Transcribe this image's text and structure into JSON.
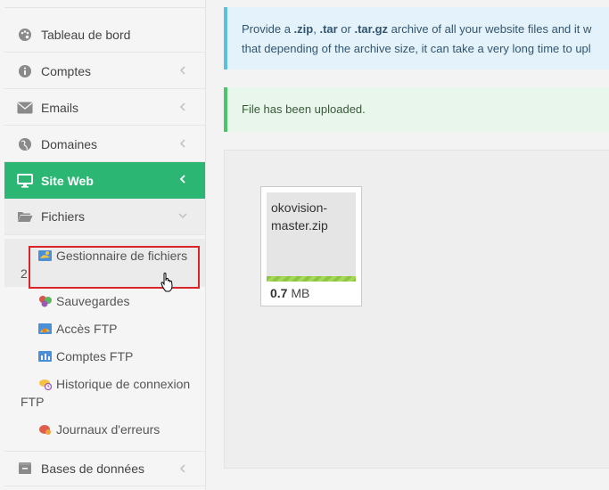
{
  "sidebar": {
    "items": [
      {
        "label": "Tableau de bord",
        "icon": "palette-icon"
      },
      {
        "label": "Comptes",
        "icon": "info-icon"
      },
      {
        "label": "Emails",
        "icon": "envelope-icon"
      },
      {
        "label": "Domaines",
        "icon": "globe-icon"
      },
      {
        "label": "Site Web",
        "icon": "monitor-icon",
        "active": true
      },
      {
        "label": "Fichiers",
        "icon": "folder-open-icon",
        "expanded": true
      },
      {
        "label": "Bases de données",
        "icon": "database-icon"
      }
    ],
    "submenu": [
      {
        "line1": "Gestionnaire de fichiers",
        "line2": "2",
        "icon": "file-manager-icon"
      },
      {
        "line1": "Sauvegardes",
        "icon": "backup-icon"
      },
      {
        "line1": "Accès FTP",
        "icon": "ftp-access-icon"
      },
      {
        "line1": "Comptes FTP",
        "icon": "ftp-accounts-icon"
      },
      {
        "line1": "Historique de connexion",
        "line2": "FTP",
        "icon": "connection-history-icon"
      },
      {
        "line1": "Journaux d'erreurs",
        "icon": "error-logs-icon"
      }
    ]
  },
  "info_alert": {
    "p1": "Provide a ",
    "ext1": ".zip",
    "p2": ", ",
    "ext2": ".tar",
    "p3": " or ",
    "ext3": ".tar.gz",
    "p4": " archive of all your website files and it w",
    "line2": "that depending of the archive size, it can take a very long time to upl"
  },
  "success_alert": {
    "text": "File has been uploaded."
  },
  "upload": {
    "file_name_line1": "okovision-",
    "file_name_line2": "master.zip",
    "size_value": "0.7",
    "size_unit": " MB",
    "progress": 1.0
  },
  "colors": {
    "accent": "#2bb673",
    "info": "#5bc0de",
    "success": "#4cc46a",
    "highlight": "#d9262b"
  }
}
